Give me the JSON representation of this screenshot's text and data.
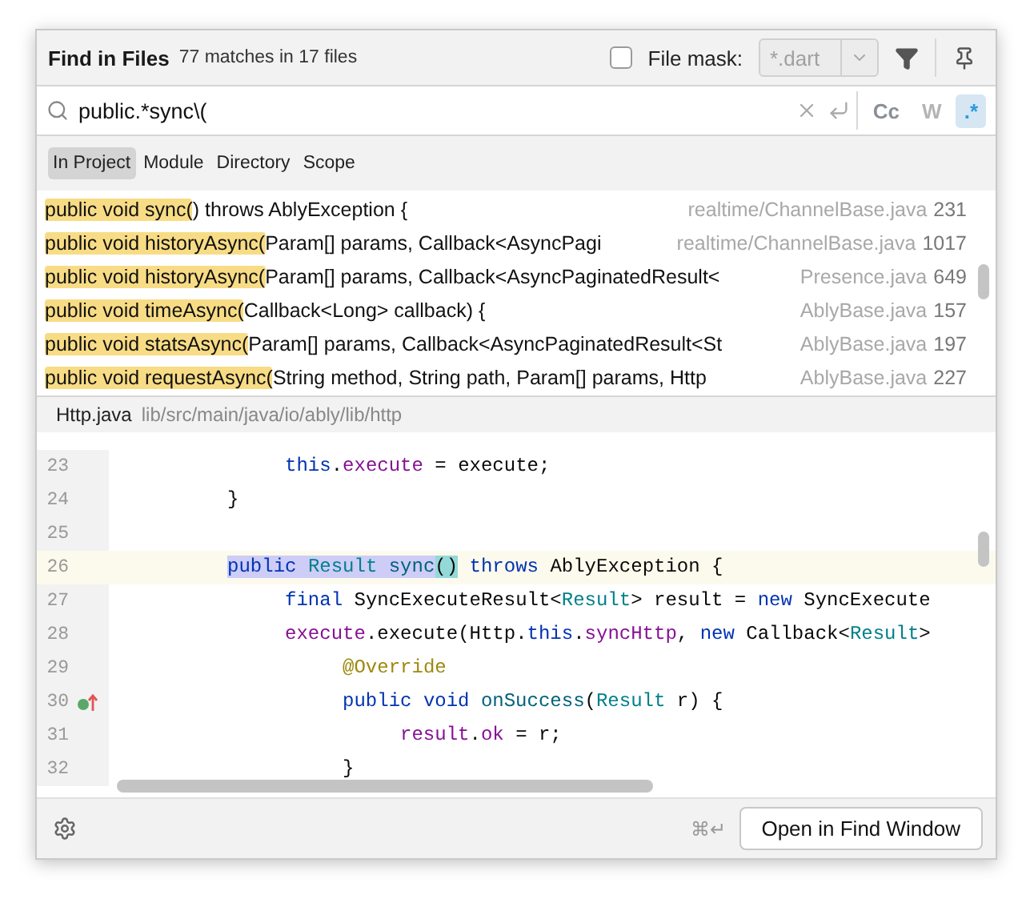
{
  "header": {
    "title": "Find in Files",
    "summary": "77 matches in 17 files",
    "file_mask": {
      "label": "File mask:",
      "checked": false,
      "value": "*.dart",
      "disabled": true
    }
  },
  "search": {
    "value": "public.*sync\\(",
    "options": [
      {
        "label": "Cc",
        "selected": false,
        "disabled": false
      },
      {
        "label": "W",
        "selected": false,
        "disabled": true
      },
      {
        "label": ".*",
        "selected": true,
        "disabled": false
      }
    ]
  },
  "scopes": [
    {
      "label": "In Project",
      "selected": true
    },
    {
      "label": "Module",
      "selected": false
    },
    {
      "label": "Directory",
      "selected": false
    },
    {
      "label": "Scope",
      "selected": false
    }
  ],
  "results": [
    {
      "match": "public void sync(",
      "text": ") throws AblyException {",
      "file": "realtime/ChannelBase.java",
      "line": "231"
    },
    {
      "match": "public void historyAsync(",
      "text": "Param[] params, Callback<AsyncPagi",
      "file": "realtime/ChannelBase.java",
      "line": "1017"
    },
    {
      "match": "public void historyAsync(",
      "text": "Param[] params, Callback<AsyncPaginatedResult<",
      "file": "Presence.java",
      "line": "649"
    },
    {
      "match": "public void timeAsync(",
      "text": "Callback<Long> callback) {",
      "file": "AblyBase.java",
      "line": "157"
    },
    {
      "match": "public void statsAsync(",
      "text": "Param[] params, Callback<AsyncPaginatedResult<St",
      "file": "AblyBase.java",
      "line": "197"
    },
    {
      "match": "public void requestAsync(",
      "text": "String method, String path, Param[] params, Http",
      "file": "AblyBase.java",
      "line": "227"
    }
  ],
  "preview": {
    "file": "Http.java",
    "path": "lib/src/main/java/io/ably/lib/http",
    "lines": [
      {
        "number": "23",
        "current": false,
        "marker": false,
        "tokens": [
          {
            "text": "               this",
            "kind": "kw"
          },
          {
            "text": ".",
            "kind": "plain"
          },
          {
            "text": "execute",
            "kind": "field"
          },
          {
            "text": " = execute;",
            "kind": "plain"
          }
        ]
      },
      {
        "number": "24",
        "current": false,
        "marker": false,
        "tokens": [
          {
            "text": "          }",
            "kind": "plain"
          }
        ]
      },
      {
        "number": "25",
        "current": false,
        "marker": false
      },
      {
        "number": "26",
        "current": true,
        "marker": false,
        "tokens": [
          {
            "text": "          public ",
            "kind": "kw",
            "found": true
          },
          {
            "text": "Result ",
            "kind": "type",
            "found": true
          },
          {
            "text": "sync",
            "kind": "method",
            "found": true
          },
          {
            "text": "()",
            "kind": "plain",
            "brace": true
          },
          {
            "text": " throws",
            "kind": "kw"
          },
          {
            "text": " AblyException {",
            "kind": "plain"
          }
        ]
      },
      {
        "number": "27",
        "current": false,
        "marker": false,
        "tokens": [
          {
            "text": "               final",
            "kind": "kw"
          },
          {
            "text": " SyncExecuteResult<",
            "kind": "plain"
          },
          {
            "text": "Result",
            "kind": "type"
          },
          {
            "text": "> result = ",
            "kind": "plain"
          },
          {
            "text": "new",
            "kind": "kw"
          },
          {
            "text": " SyncExecute",
            "kind": "plain"
          }
        ]
      },
      {
        "number": "28",
        "current": false,
        "marker": false,
        "tokens": [
          {
            "text": "               execute",
            "kind": "field"
          },
          {
            "text": ".execute(Http.",
            "kind": "plain"
          },
          {
            "text": "this",
            "kind": "kw"
          },
          {
            "text": ".",
            "kind": "plain"
          },
          {
            "text": "syncHttp",
            "kind": "field"
          },
          {
            "text": ", ",
            "kind": "plain"
          },
          {
            "text": "new",
            "kind": "kw"
          },
          {
            "text": " Callback<",
            "kind": "plain"
          },
          {
            "text": "Result",
            "kind": "type"
          },
          {
            "text": ">",
            "kind": "plain"
          }
        ]
      },
      {
        "number": "29",
        "current": false,
        "marker": false,
        "tokens": [
          {
            "text": "                    @Override",
            "kind": "annotation"
          }
        ]
      },
      {
        "number": "30",
        "current": false,
        "marker": true,
        "tokens": [
          {
            "text": "                    public void",
            "kind": "kw"
          },
          {
            "text": " onSuccess",
            "kind": "method"
          },
          {
            "text": "(",
            "kind": "plain"
          },
          {
            "text": "Result",
            "kind": "type"
          },
          {
            "text": " r) {",
            "kind": "plain"
          }
        ]
      },
      {
        "number": "31",
        "current": false,
        "marker": false,
        "tokens": [
          {
            "text": "                         result",
            "kind": "field"
          },
          {
            "text": ".",
            "kind": "plain"
          },
          {
            "text": "ok",
            "kind": "field"
          },
          {
            "text": " = r;",
            "kind": "plain"
          }
        ]
      },
      {
        "number": "32",
        "current": false,
        "marker": false,
        "tokens": [
          {
            "text": "                    }",
            "kind": "plain"
          }
        ]
      }
    ]
  },
  "footer": {
    "shortcut": "⌘↵",
    "button": "Open in Find Window"
  }
}
